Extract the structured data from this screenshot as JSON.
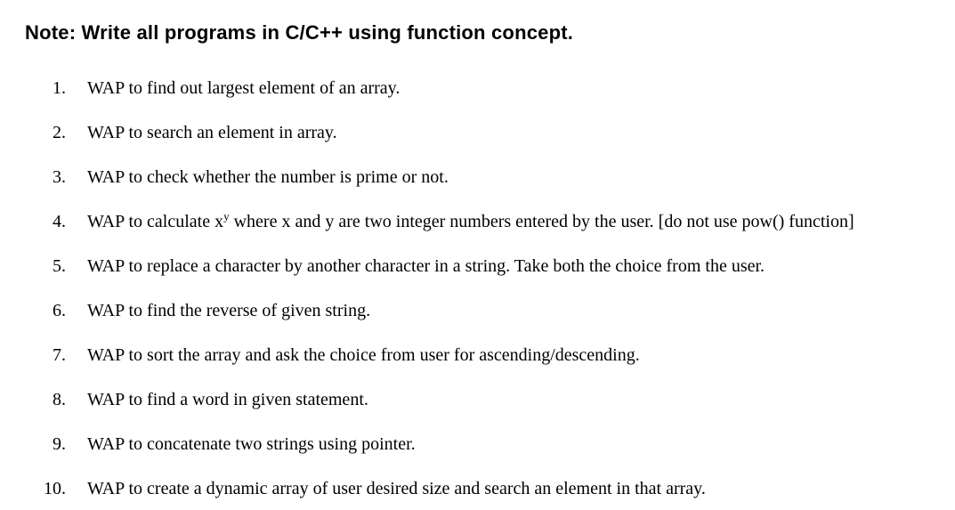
{
  "heading": "Note: Write all programs in C/C++ using function concept.",
  "items": [
    {
      "num": "1.",
      "text": "WAP to find out largest element of an array."
    },
    {
      "num": "2.",
      "text": "WAP to search an element in array."
    },
    {
      "num": "3.",
      "text": "WAP to check whether the number is prime or not."
    },
    {
      "num": "4.",
      "text": "WAP to calculate x__SUP__y__ENDSUP__ where x and y are two integer numbers entered by the user. [do not use pow() function]"
    },
    {
      "num": "5.",
      "text": "WAP to replace a character by another character in a string. Take both the choice from the user."
    },
    {
      "num": "6.",
      "text": "WAP to find the reverse of given string."
    },
    {
      "num": "7.",
      "text": "WAP to sort the array and ask the choice from user for ascending/descending."
    },
    {
      "num": "8.",
      "text": "WAP to find a word in given statement."
    },
    {
      "num": "9.",
      "text": "WAP to concatenate two strings using pointer."
    },
    {
      "num": "10.",
      "text": "WAP to create a dynamic array of user desired size and search an element in that array."
    }
  ]
}
